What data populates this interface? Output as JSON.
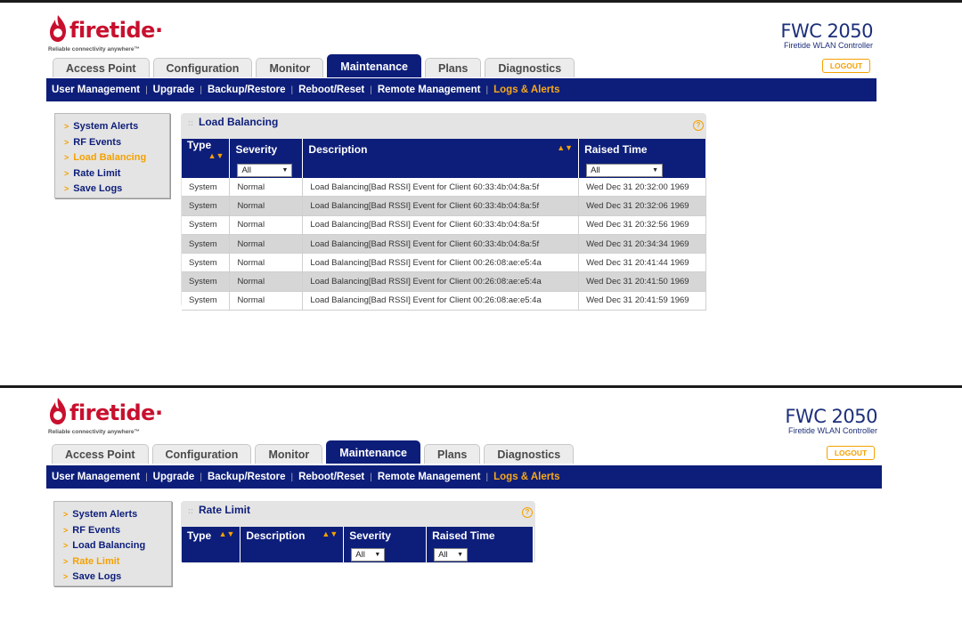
{
  "screens": [
    {
      "logo": {
        "word": "firetide",
        "tagline": "Reliable connectivity anywhere™"
      },
      "product": {
        "name": "FWC 2050",
        "subtitle": "Firetide WLAN Controller",
        "logout_label": "LOGOUT"
      },
      "tabs": [
        "Access Point",
        "Configuration",
        "Monitor",
        "Maintenance",
        "Plans",
        "Diagnostics"
      ],
      "active_tab": "Maintenance",
      "subnav": [
        "User Management",
        "Upgrade",
        "Backup/Restore",
        "Reboot/Reset",
        "Remote Management",
        "Logs & Alerts"
      ],
      "active_subnav": "Logs & Alerts",
      "sidebar": [
        "System Alerts",
        "RF Events",
        "Load Balancing",
        "Rate Limit",
        "Save Logs"
      ],
      "active_sidebar": "Load Balancing",
      "panel_title": "Load Balancing",
      "columns": [
        "Type",
        "Severity",
        "Description",
        "Raised Time"
      ],
      "filters": {
        "severity": "All",
        "raised_time": "All"
      },
      "rows": [
        [
          "System",
          "Normal",
          "Load Balancing[Bad RSSI] Event for Client 60:33:4b:04:8a:5f",
          "Wed Dec 31 20:32:00 1969"
        ],
        [
          "System",
          "Normal",
          "Load Balancing[Bad RSSI] Event for Client 60:33:4b:04:8a:5f",
          "Wed Dec 31 20:32:06 1969"
        ],
        [
          "System",
          "Normal",
          "Load Balancing[Bad RSSI] Event for Client 60:33:4b:04:8a:5f",
          "Wed Dec 31 20:32:56 1969"
        ],
        [
          "System",
          "Normal",
          "Load Balancing[Bad RSSI] Event for Client 60:33:4b:04:8a:5f",
          "Wed Dec 31 20:34:34 1969"
        ],
        [
          "System",
          "Normal",
          "Load Balancing[Bad RSSI] Event for Client 00:26:08:ae:e5:4a",
          "Wed Dec 31 20:41:44 1969"
        ],
        [
          "System",
          "Normal",
          "Load Balancing[Bad RSSI] Event for Client 00:26:08:ae:e5:4a",
          "Wed Dec 31 20:41:50 1969"
        ],
        [
          "System",
          "Normal",
          "Load Balancing[Bad RSSI] Event for Client 00:26:08:ae:e5:4a",
          "Wed Dec 31 20:41:59 1969"
        ]
      ]
    },
    {
      "logo": {
        "word": "firetide",
        "tagline": "Reliable connectivity anywhere™"
      },
      "product": {
        "name": "FWC 2050",
        "subtitle": "Firetide WLAN Controller",
        "logout_label": "LOGOUT"
      },
      "tabs": [
        "Access Point",
        "Configuration",
        "Monitor",
        "Maintenance",
        "Plans",
        "Diagnostics"
      ],
      "active_tab": "Maintenance",
      "subnav": [
        "User Management",
        "Upgrade",
        "Backup/Restore",
        "Reboot/Reset",
        "Remote Management",
        "Logs & Alerts"
      ],
      "active_subnav": "Logs & Alerts",
      "sidebar": [
        "System Alerts",
        "RF Events",
        "Load Balancing",
        "Rate Limit",
        "Save Logs"
      ],
      "active_sidebar": "Rate Limit",
      "panel_title": "Rate Limit",
      "columns": [
        "Type",
        "Description",
        "Severity",
        "Raised Time"
      ],
      "filters": {
        "severity": "All",
        "raised_time": "All"
      },
      "rows": []
    }
  ],
  "icons": {
    "help": "help-icon",
    "sort": "sort-arrows-icon",
    "chevron": "chevron-right-icon",
    "dropdown": "dropdown-arrow-icon"
  },
  "colors": {
    "nav_blue": "#0d1e7a",
    "accent_orange": "#f5a100",
    "brand_red": "#c8102e"
  }
}
